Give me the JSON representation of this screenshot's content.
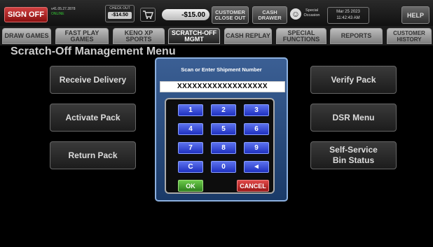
{
  "topbar": {
    "sign_off": "SIGN OFF",
    "version": "v41.05.27.2878",
    "version_status": "ONLINE",
    "check_out_label": "CHECK OUT",
    "check_out_value": "-$14.50",
    "total": "-$15.00",
    "customer_close_out": "CUSTOMER CLOSE OUT",
    "cash_drawer": "CASH DRAWER",
    "special_occasion": "Special Occasion",
    "date": "Mar 25 2023",
    "time": "11:42:43 AM",
    "help": "HELP"
  },
  "tabs": [
    "DRAW GAMES",
    "FAST PLAY GAMES",
    "KENO XP SPORTS",
    "SCRATCH-OFF MGMT",
    "CASH REPLAY",
    "SPECIAL FUNCTIONS",
    "REPORTS",
    "CUSTOMER HISTORY"
  ],
  "page_title": "Scratch-Off Management Menu",
  "menu": {
    "receive_delivery": "Receive Delivery",
    "activate_pack": "Activate Pack",
    "return_pack": "Return Pack",
    "verify_pack": "Verify Pack",
    "dsr_menu": "DSR Menu",
    "self_service_bin_status": "Self-Service Bin Status"
  },
  "dialog": {
    "title": "Scan or Enter Shipment Number",
    "entry_value": "XXXXXXXXXXXXXXXXXX",
    "keys": [
      "1",
      "2",
      "3",
      "4",
      "5",
      "6",
      "7",
      "8",
      "9",
      "C",
      "0",
      "◄"
    ],
    "ok": "OK",
    "cancel": "CANCEL"
  }
}
